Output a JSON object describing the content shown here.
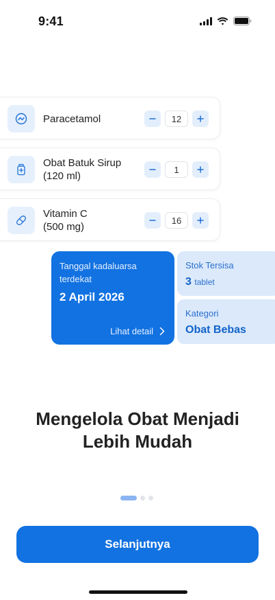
{
  "status_bar": {
    "time": "9:41"
  },
  "medicines": [
    {
      "name_line1": "Paracetamol",
      "name_line2": "",
      "quantity": "12",
      "icon": "pill-tablet-icon"
    },
    {
      "name_line1": "Obat Batuk Sirup",
      "name_line2": "(120 ml)",
      "quantity": "1",
      "icon": "syrup-bottle-icon"
    },
    {
      "name_line1": "Vitamin C",
      "name_line2": "(500 mg)",
      "quantity": "16",
      "icon": "capsule-icon"
    }
  ],
  "expiry_card": {
    "label": "Tanggal kadaluarsa terdekat",
    "date": "2 April 2026",
    "link": "Lihat detail"
  },
  "stock_card": {
    "label": "Stok Tersisa",
    "value": "3",
    "unit": "tablet"
  },
  "category_card": {
    "label": "Kategori",
    "value": "Obat Bebas"
  },
  "headline": {
    "line1": "Mengelola Obat Menjadi",
    "line2": "Lebih Mudah"
  },
  "pagination": {
    "current": 1,
    "total": 3
  },
  "cta": {
    "label": "Selanjutnya"
  },
  "colors": {
    "primary": "#1272e1",
    "light_blue": "#dbe9fb",
    "icon_bg": "#e6f0fd"
  }
}
